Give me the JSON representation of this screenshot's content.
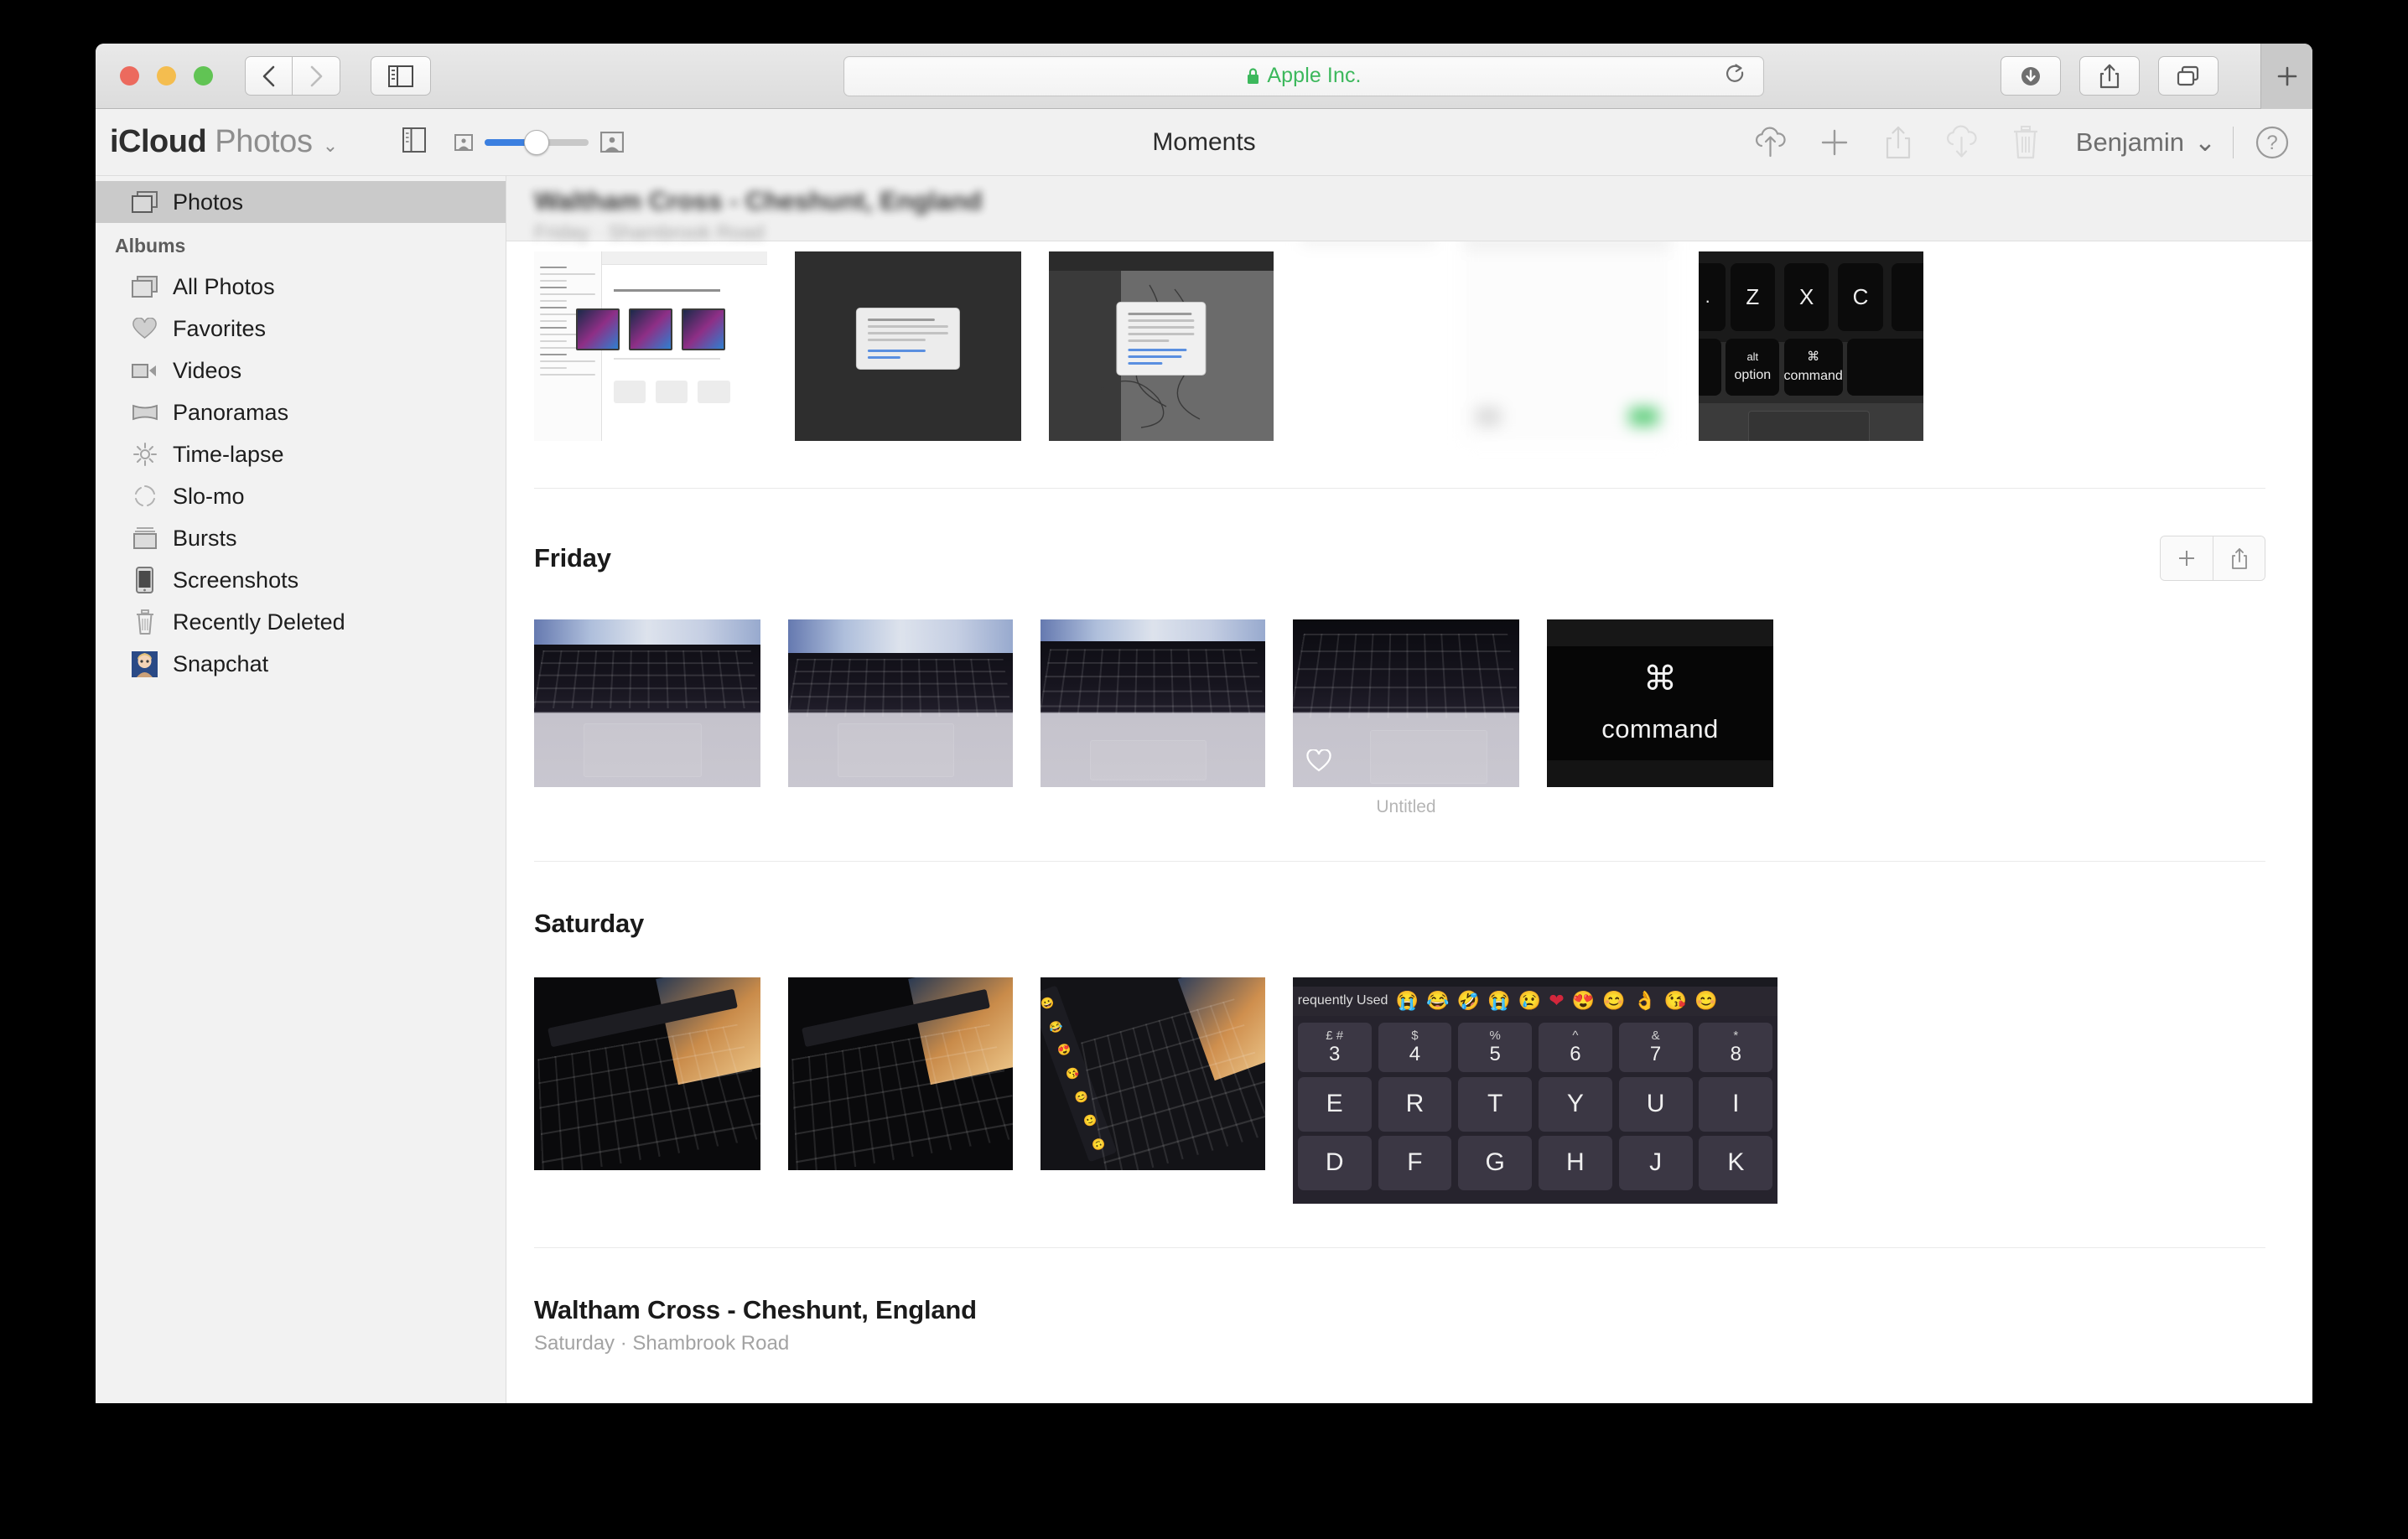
{
  "browser": {
    "url_text": "Apple Inc.",
    "lock_icon": "lock-icon",
    "back_icon": "chevron-left-icon",
    "forward_icon": "chevron-right-icon",
    "sidebar_toggle_icon": "sidebar-toggle-icon",
    "reload_icon": "reload-icon",
    "downloads_icon": "downloads-icon",
    "share_icon": "share-icon",
    "tabs_icon": "tab-overview-icon",
    "newtab_icon": "plus-icon"
  },
  "app": {
    "brand_primary": "iCloud",
    "brand_secondary": "Photos",
    "brand_chevron": "⌄",
    "title": "Moments",
    "account_name": "Benjamin",
    "account_chevron": "⌄",
    "help_label": "?",
    "zoom_slider_value": 50,
    "toolbar_icons": {
      "sidebar_toggle": "sidebar-toggle-icon",
      "thumb_small": "small-photo-icon",
      "thumb_large": "large-photo-icon",
      "upload": "cloud-upload-icon",
      "add": "plus-icon",
      "share": "share-icon",
      "download": "cloud-download-icon",
      "delete": "trash-icon"
    }
  },
  "sidebar": {
    "top_item": {
      "label": "Photos",
      "icon": "photos-stack-icon",
      "selected": true
    },
    "section_label": "Albums",
    "items": [
      {
        "label": "All Photos",
        "icon": "photos-stack-icon"
      },
      {
        "label": "Favorites",
        "icon": "heart-icon"
      },
      {
        "label": "Videos",
        "icon": "video-camera-icon"
      },
      {
        "label": "Panoramas",
        "icon": "panorama-icon"
      },
      {
        "label": "Time-lapse",
        "icon": "timelapse-icon"
      },
      {
        "label": "Slo-mo",
        "icon": "slomo-icon"
      },
      {
        "label": "Bursts",
        "icon": "bursts-icon"
      },
      {
        "label": "Screenshots",
        "icon": "iphone-icon"
      },
      {
        "label": "Recently Deleted",
        "icon": "trash-icon"
      },
      {
        "label": "Snapchat",
        "icon": "album-thumbnail-avatar"
      }
    ]
  },
  "content": {
    "sticky_header": {
      "title": "Waltham Cross - Cheshunt, England",
      "subtitle": "Friday  ·  Shambrook Road",
      "blurred": true
    },
    "sections": [
      {
        "id": "partial-top",
        "title": "",
        "subtitle": "",
        "show_actions": false,
        "photos": [
          {
            "kind": "screenshot-mail",
            "caption": ""
          },
          {
            "kind": "screenshot-dark-dialog",
            "caption": ""
          },
          {
            "kind": "screenshot-drawing",
            "caption": ""
          },
          {
            "kind": "screenshot-blurred-a",
            "caption": ""
          },
          {
            "kind": "screenshot-blurred-b",
            "caption": ""
          },
          {
            "kind": "keyboard-zxc",
            "caption": ""
          }
        ]
      },
      {
        "id": "friday",
        "title": "Friday",
        "subtitle": "",
        "show_actions": true,
        "add_icon": "plus-icon",
        "share_icon": "share-icon",
        "photos": [
          {
            "kind": "macbook-keyboard-1",
            "caption": ""
          },
          {
            "kind": "macbook-keyboard-2",
            "caption": ""
          },
          {
            "kind": "macbook-keyboard-3",
            "caption": ""
          },
          {
            "kind": "macbook-keyboard-4",
            "caption": "Untitled",
            "favorite": true,
            "favorite_icon": "heart-outline-icon"
          },
          {
            "kind": "command-key",
            "caption": "",
            "glyph": "⌘",
            "word": "command"
          }
        ]
      },
      {
        "id": "saturday",
        "title": "Saturday",
        "subtitle": "",
        "show_actions": false,
        "photos": [
          {
            "kind": "touchbar-dialog-1",
            "caption": ""
          },
          {
            "kind": "touchbar-dialog-2",
            "caption": ""
          },
          {
            "kind": "touchbar-emoji-angle",
            "caption": ""
          },
          {
            "kind": "touchbar-emoji-wide",
            "caption": "",
            "touchbar_label": "requently Used",
            "emoji": [
              "😭",
              "😂",
              "🤣",
              "😭",
              "😭",
              "❤️",
              "😍",
              "😊",
              "👌",
              "😘",
              "😊"
            ],
            "number_keys": [
              {
                "up": "£ #",
                "main": "3"
              },
              {
                "up": "$",
                "main": "4"
              },
              {
                "up": "%",
                "main": "5"
              },
              {
                "up": "^",
                "main": "6"
              },
              {
                "up": "&",
                "main": "7"
              },
              {
                "up": "*",
                "main": "8"
              }
            ],
            "letter_row_1": [
              "E",
              "R",
              "T",
              "Y",
              "U",
              "I"
            ],
            "letter_row_2": [
              "D",
              "F",
              "G",
              "H",
              "J",
              "K"
            ]
          }
        ]
      },
      {
        "id": "waltham-cross",
        "title": "Waltham Cross - Cheshunt, England",
        "subtitle": "Saturday  ·  Shambrook Road",
        "show_actions": false,
        "photos": []
      }
    ]
  },
  "colors": {
    "accent_blue": "#3b7fe0",
    "secure_green": "#3cb85c",
    "sidebar_bg": "#f2f2f2",
    "selected_row": "#cacaca",
    "toolbar_bg": "#f1f1f1"
  }
}
